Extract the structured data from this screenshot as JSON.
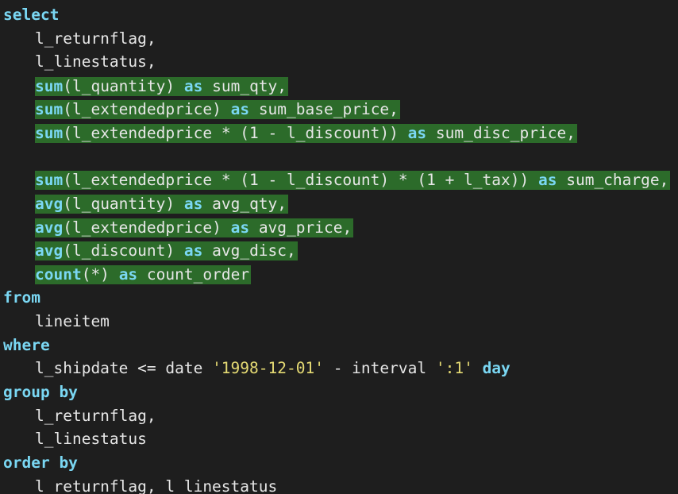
{
  "editor": {
    "lines": [
      {
        "kw": "select"
      },
      {
        "text": "l_returnflag,"
      },
      {
        "text": "l_linestatus,"
      },
      {
        "fn": "sum",
        "args": "(l_quantity)",
        "as": "as",
        "alias": "sum_qty,"
      },
      {
        "fn": "sum",
        "args": "(l_extendedprice)",
        "as": "as",
        "alias": "sum_base_price,"
      },
      {
        "fn": "sum",
        "args": "(l_extendedprice * (1 - l_discount))",
        "as": "as",
        "alias": "sum_disc_price,"
      },
      {},
      {
        "fn": "sum",
        "args": "(l_extendedprice * (1 - l_discount) * (1 + l_tax))",
        "as": "as",
        "alias": "sum_charge,"
      },
      {
        "fn": "avg",
        "args": "(l_quantity)",
        "as": "as",
        "alias": "avg_qty,"
      },
      {
        "fn": "avg",
        "args": "(l_extendedprice)",
        "as": "as",
        "alias": "avg_price,"
      },
      {
        "fn": "avg",
        "args": "(l_discount)",
        "as": "as",
        "alias": "avg_disc,"
      },
      {
        "fn": "count",
        "args": "(*)",
        "as": "as",
        "alias": "count_order"
      },
      {
        "kw": "from"
      },
      {
        "text": "lineitem"
      },
      {
        "kw": "where"
      },
      {
        "text": "l_shipdate <= date ",
        "str1": "'1998-12-01'",
        "mid": " - interval ",
        "str2": "':1'",
        "kw2": "day"
      },
      {
        "kw": "group by"
      },
      {
        "text": "l_returnflag,"
      },
      {
        "text": "l_linestatus"
      },
      {
        "kw": "order by"
      },
      {
        "text": "l_returnflag, l_linestatus"
      }
    ]
  },
  "colors": {
    "background": "#1e1e1e",
    "keyword": "#7ad7f3",
    "string": "#e6db74",
    "highlight": "#2c6b2a"
  }
}
